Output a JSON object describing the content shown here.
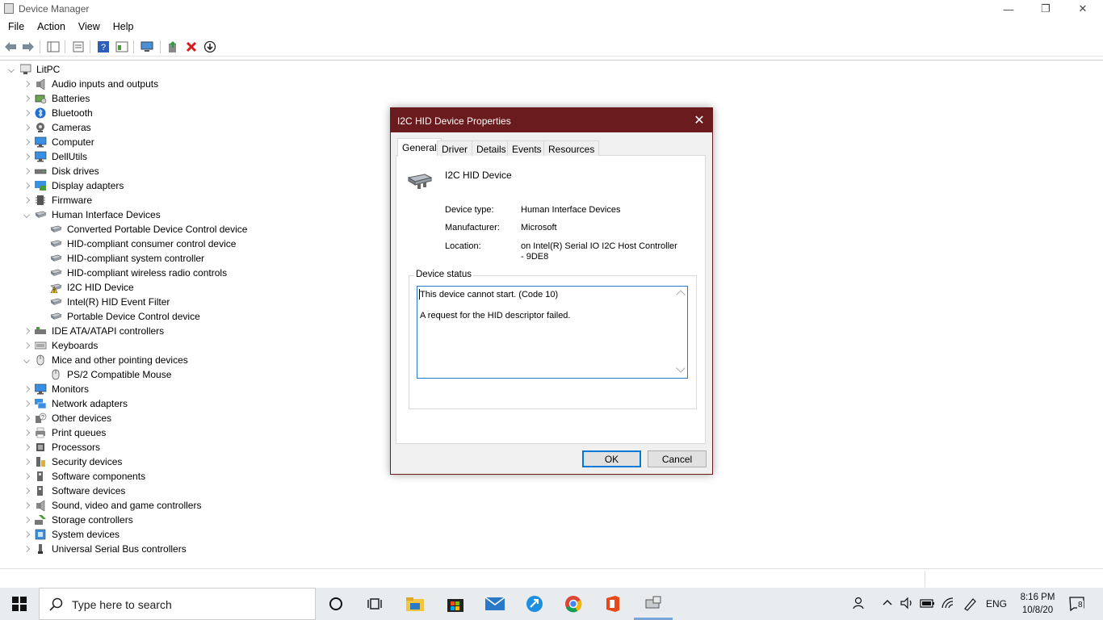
{
  "window": {
    "title": "Device Manager",
    "controls": {
      "minimize": "—",
      "restore": "❐",
      "close": "✕"
    }
  },
  "menu": [
    "File",
    "Action",
    "View",
    "Help"
  ],
  "tree": {
    "root": "LitPC",
    "items": [
      {
        "label": "Audio inputs and outputs",
        "icon": "speaker-icon",
        "expanded": false
      },
      {
        "label": "Batteries",
        "icon": "battery-icon",
        "expanded": false
      },
      {
        "label": "Bluetooth",
        "icon": "bluetooth-icon",
        "expanded": false
      },
      {
        "label": "Cameras",
        "icon": "camera-icon",
        "expanded": false
      },
      {
        "label": "Computer",
        "icon": "monitor-icon",
        "expanded": false
      },
      {
        "label": "DellUtils",
        "icon": "monitor-icon",
        "expanded": false
      },
      {
        "label": "Disk drives",
        "icon": "disk-icon",
        "expanded": false
      },
      {
        "label": "Display adapters",
        "icon": "display-adapter-icon",
        "expanded": false
      },
      {
        "label": "Firmware",
        "icon": "firmware-icon",
        "expanded": false
      },
      {
        "label": "Human Interface Devices",
        "icon": "hid-icon",
        "expanded": true,
        "children": [
          {
            "label": "Converted Portable Device Control device",
            "icon": "hid-icon"
          },
          {
            "label": "HID-compliant consumer control device",
            "icon": "hid-icon"
          },
          {
            "label": "HID-compliant system controller",
            "icon": "hid-icon"
          },
          {
            "label": "HID-compliant wireless radio controls",
            "icon": "hid-icon"
          },
          {
            "label": "I2C HID Device",
            "icon": "hid-warning-icon"
          },
          {
            "label": "Intel(R) HID Event Filter",
            "icon": "hid-icon"
          },
          {
            "label": "Portable Device Control device",
            "icon": "hid-icon"
          }
        ]
      },
      {
        "label": "IDE ATA/ATAPI controllers",
        "icon": "ide-icon",
        "expanded": false
      },
      {
        "label": "Keyboards",
        "icon": "keyboard-icon",
        "expanded": false
      },
      {
        "label": "Mice and other pointing devices",
        "icon": "mouse-icon",
        "expanded": true,
        "children": [
          {
            "label": "PS/2 Compatible Mouse",
            "icon": "mouse-icon"
          }
        ]
      },
      {
        "label": "Monitors",
        "icon": "monitor-icon",
        "expanded": false
      },
      {
        "label": "Network adapters",
        "icon": "network-icon",
        "expanded": false
      },
      {
        "label": "Other devices",
        "icon": "unknown-device-icon",
        "expanded": false
      },
      {
        "label": "Print queues",
        "icon": "printer-icon",
        "expanded": false
      },
      {
        "label": "Processors",
        "icon": "processor-icon",
        "expanded": false
      },
      {
        "label": "Security devices",
        "icon": "security-icon",
        "expanded": false
      },
      {
        "label": "Software components",
        "icon": "software-icon",
        "expanded": false
      },
      {
        "label": "Software devices",
        "icon": "software-icon",
        "expanded": false
      },
      {
        "label": "Sound, video and game controllers",
        "icon": "speaker-icon",
        "expanded": false
      },
      {
        "label": "Storage controllers",
        "icon": "storage-icon",
        "expanded": false
      },
      {
        "label": "System devices",
        "icon": "system-icon",
        "expanded": false
      },
      {
        "label": "Universal Serial Bus controllers",
        "icon": "usb-icon",
        "expanded": false
      }
    ]
  },
  "dialog": {
    "title": "I2C HID Device Properties",
    "close": "✕",
    "tabs": [
      "General",
      "Driver",
      "Details",
      "Events",
      "Resources"
    ],
    "device_name": "I2C HID Device",
    "props": [
      {
        "key": "Device type:",
        "value": "Human Interface Devices"
      },
      {
        "key": "Manufacturer:",
        "value": "Microsoft"
      },
      {
        "key": "Location:",
        "value": "on Intel(R) Serial IO I2C Host Controller - 9DE8"
      }
    ],
    "status_legend": "Device status",
    "status_line1": "This device cannot start. (Code 10)",
    "status_line2": "A request for the HID descriptor failed.",
    "ok": "OK",
    "cancel": "Cancel"
  },
  "taskbar": {
    "search_placeholder": "Type here to search",
    "lang": "ENG",
    "time": "8:16 PM",
    "date": "10/8/20",
    "notifications": "8"
  },
  "colors": {
    "dialog_title": "#691b1e",
    "accent": "#0078d7",
    "error_red": "#d41a1a"
  }
}
